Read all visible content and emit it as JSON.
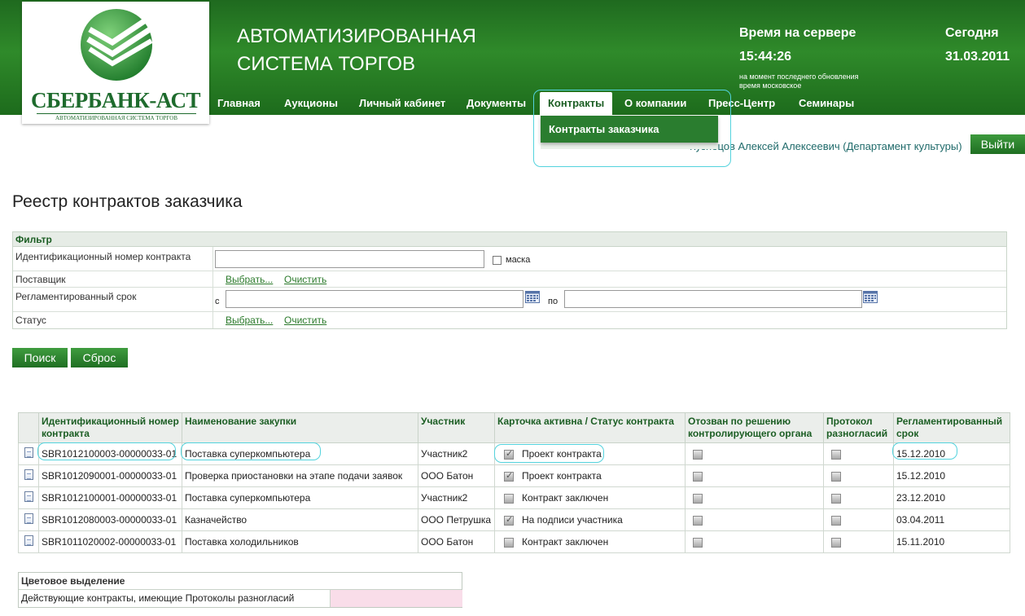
{
  "header": {
    "logo_name": "СБЕРБАНК-АСТ",
    "logo_subtitle": "АВТОМАТИЗИРОВАННАЯ СИСТЕМА ТОРГОВ",
    "system_title_line1": "АВТОМАТИЗИРОВАННАЯ",
    "system_title_line2": "СИСТЕМА ТОРГОВ",
    "server_time_label": "Время на сервере",
    "server_time": "15:44:26",
    "server_note_line1": "на момент последнего обновления",
    "server_note_line2": "время московское",
    "today_label": "Сегодня",
    "today_date": "31.03.2011",
    "brand_color": "#2f8a2a"
  },
  "nav": {
    "items": [
      {
        "label": "Главная"
      },
      {
        "label": "Аукционы"
      },
      {
        "label": "Личный кабинет"
      },
      {
        "label": "Документы"
      },
      {
        "label": "Контракты",
        "active": true
      },
      {
        "label": "О компании"
      },
      {
        "label": "Пресс-Центр"
      },
      {
        "label": "Семинары"
      }
    ],
    "dropdown_item": "Контракты заказчика"
  },
  "user": {
    "name": "Кузнецов Алексей Алексеевич (Департамент культуры)",
    "logout_label": "Выйти"
  },
  "page_title": "Реестр контрактов заказчика",
  "filter": {
    "title": "Фильтр",
    "contract_id_label": "Идентификационный номер контракта",
    "contract_id_value": "",
    "mask_label": "маска",
    "supplier_label": "Поставщик",
    "deadline_label": "Регламентированный срок",
    "from_label": "с",
    "to_label": "по",
    "status_label": "Статус",
    "select_link": "Выбрать...",
    "clear_link": "Очистить",
    "search_button": "Поиск",
    "reset_button": "Сброс"
  },
  "table": {
    "headers": [
      "Идентификационный номер контракта",
      "Наименование закупки",
      "Участник",
      "Карточка активна / Статус контракта",
      "Отозван по решению контролирующего органа",
      "Протокол разногласий",
      "Регламентированный срок"
    ],
    "rows": [
      {
        "id": "SBR1012100003-00000033-01",
        "name": "Поставка суперкомпьютера",
        "participant": "Участник2",
        "active": true,
        "status": "Проект контракта",
        "revoked": false,
        "protocol": false,
        "deadline": "15.12.2010"
      },
      {
        "id": "SBR1012090001-00000033-01",
        "name": "Проверка приостановки на этапе подачи заявок",
        "participant": "ООО Батон",
        "active": true,
        "status": "Проект контракта",
        "revoked": false,
        "protocol": false,
        "deadline": "15.12.2010"
      },
      {
        "id": "SBR1012100001-00000033-01",
        "name": "Поставка суперкомпьютера",
        "participant": "Участник2",
        "active": false,
        "status": "Контракт заключен",
        "revoked": false,
        "protocol": false,
        "deadline": "23.12.2010"
      },
      {
        "id": "SBR1012080003-00000033-01",
        "name": "Казначейство",
        "participant": "ООО Петрушка",
        "active": true,
        "status": "На подписи участника",
        "revoked": false,
        "protocol": false,
        "deadline": "03.04.2011"
      },
      {
        "id": "SBR1011020002-00000033-01",
        "name": "Поставка холодильников",
        "participant": "ООО Батон",
        "active": false,
        "status": "Контракт заключен",
        "revoked": false,
        "protocol": false,
        "deadline": "15.11.2010"
      }
    ]
  },
  "legend": {
    "title": "Цветовое выделение",
    "row_label": "Действующие контракты, имеющие Протоколы разногласий",
    "swatch_color": "#f9dde9"
  }
}
